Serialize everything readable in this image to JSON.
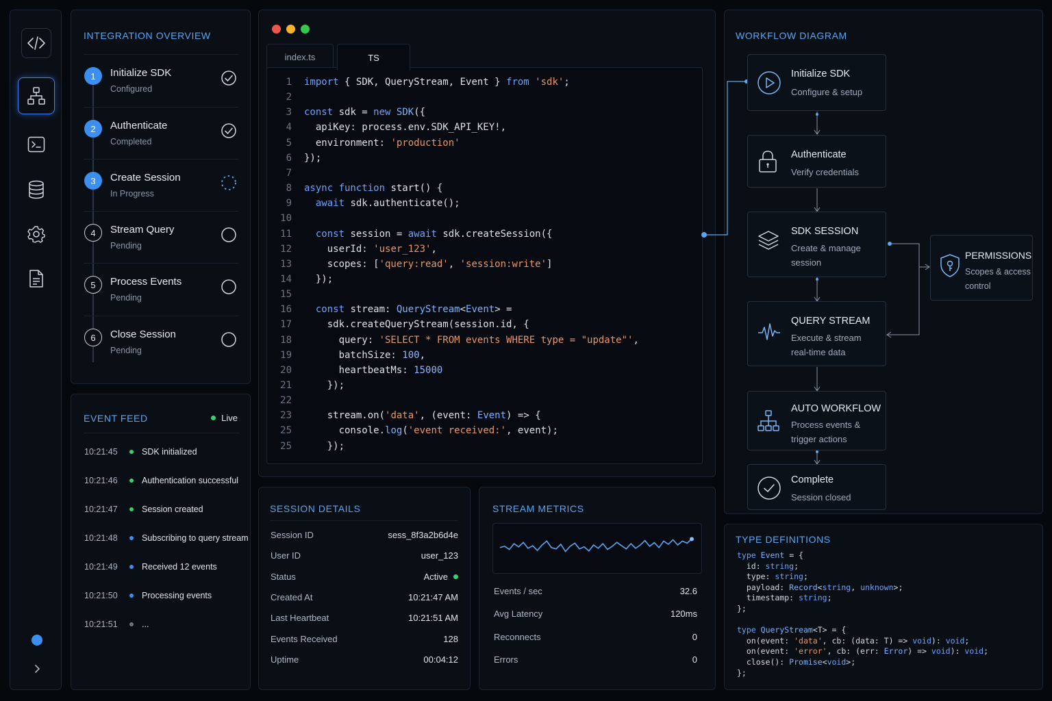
{
  "sidebar": {
    "icons": [
      "code-icon",
      "workflow-icon",
      "terminal-icon",
      "database-icon",
      "gear-icon",
      "document-icon"
    ],
    "active": "workflow-icon",
    "expand": "chevron-right-icon"
  },
  "overview": {
    "title": "INTEGRATION OVERVIEW",
    "steps": [
      {
        "num": "1",
        "title": "Initialize SDK",
        "status": "Configured",
        "state": "done"
      },
      {
        "num": "2",
        "title": "Authenticate",
        "status": "Completed",
        "state": "done"
      },
      {
        "num": "3",
        "title": "Create Session",
        "status": "In Progress",
        "state": "progress"
      },
      {
        "num": "4",
        "title": "Stream Query",
        "status": "Pending",
        "state": "pending"
      },
      {
        "num": "5",
        "title": "Process Events",
        "status": "Pending",
        "state": "pending"
      },
      {
        "num": "6",
        "title": "Close Session",
        "status": "Pending",
        "state": "pending"
      }
    ]
  },
  "feed": {
    "title": "EVENT FEED",
    "live": "Live",
    "rows": [
      {
        "time": "10:21:45",
        "msg": "SDK initialized",
        "color": "#3ccf6e"
      },
      {
        "time": "10:21:46",
        "msg": "Authentication successful",
        "color": "#3ccf6e"
      },
      {
        "time": "10:21:47",
        "msg": "Session created",
        "color": "#3ccf6e"
      },
      {
        "time": "10:21:48",
        "msg": "Subscribing to query stream",
        "color": "#3b8ff0"
      },
      {
        "time": "10:21:49",
        "msg": "Received 12 events",
        "color": "#3b8ff0"
      },
      {
        "time": "10:21:50",
        "msg": "Processing events",
        "color": "#3b8ff0"
      },
      {
        "time": "10:21:51",
        "msg": "...",
        "color": "#6b7686"
      }
    ]
  },
  "editor": {
    "tabs": [
      "index.ts",
      "TS"
    ],
    "active_tab": "TS",
    "lines": [
      {
        "n": "1",
        "src": "<span class='k'>import</span> { SDK, QueryStream, Event } <span class='k'>from</span> <span class='s'>'sdk'</span>;"
      },
      {
        "n": "2",
        "src": ""
      },
      {
        "n": "3",
        "src": "<span class='k'>const</span> sdk = <span class='k'>new</span> <span class='t'>SDK</span>({"
      },
      {
        "n": "4",
        "src": "  apiKey: process.env.SDK_API_KEY!,"
      },
      {
        "n": "5",
        "src": "  environment: <span class='s'>'production'</span>"
      },
      {
        "n": "6",
        "src": "});"
      },
      {
        "n": "7",
        "src": ""
      },
      {
        "n": "8",
        "src": "<span class='k'>async function</span> <span class='f'>start</span>() {"
      },
      {
        "n": "9",
        "src": "  <span class='k'>await</span> sdk.authenticate();"
      },
      {
        "n": "10",
        "src": ""
      },
      {
        "n": "11",
        "src": "  <span class='k'>const</span> session = <span class='k'>await</span> sdk.createSession({"
      },
      {
        "n": "12",
        "src": "    userId: <span class='s'>'user_123'</span>,"
      },
      {
        "n": "13",
        "src": "    scopes: [<span class='s'>'query:read'</span>, <span class='s'>'session:write'</span>]"
      },
      {
        "n": "14",
        "src": "  });"
      },
      {
        "n": "15",
        "src": ""
      },
      {
        "n": "16",
        "src": "  <span class='k'>const</span> stream: <span class='t'>QueryStream</span>&lt;<span class='t'>Event</span>&gt; ="
      },
      {
        "n": "17",
        "src": "    sdk.createQueryStream(session.id, {"
      },
      {
        "n": "18",
        "src": "      query: <span class='s'>'SELECT * FROM events WHERE type = \"update\"'</span>,"
      },
      {
        "n": "19",
        "src": "      batchSize: <span class='n'>100</span>,"
      },
      {
        "n": "20",
        "src": "      heartbeatMs: <span class='n'>15000</span>"
      },
      {
        "n": "21",
        "src": "    });"
      },
      {
        "n": "22",
        "src": ""
      },
      {
        "n": "23",
        "src": "    stream.on(<span class='s'>'data'</span>, (event: <span class='t'>Event</span>) =&gt; {"
      },
      {
        "n": "25",
        "src": "      console.<span class='t'>log</span>(<span class='s'>'event received:'</span>, event);"
      },
      {
        "n": "25",
        "src": "    });"
      }
    ]
  },
  "session": {
    "title": "SESSION DETAILS",
    "rows": [
      {
        "key": "Session ID",
        "val": "sess_8f3a2b6d4e"
      },
      {
        "key": "User ID",
        "val": "user_123"
      },
      {
        "key": "Status",
        "val": "Active"
      },
      {
        "key": "Created At",
        "val": "10:21:47 AM"
      },
      {
        "key": "Last Heartbeat",
        "val": "10:21:51 AM"
      },
      {
        "key": "Events Received",
        "val": "128"
      },
      {
        "key": "Uptime",
        "val": "00:04:12"
      }
    ],
    "status_color": "#3ccf6e"
  },
  "metrics": {
    "title": "STREAM METRICS",
    "rows": [
      {
        "key": "Events / sec",
        "val": "32.6"
      },
      {
        "key": "Avg Latency",
        "val": "120ms"
      },
      {
        "key": "Reconnects",
        "val": "0"
      },
      {
        "key": "Errors",
        "val": "0"
      }
    ],
    "sparkline": [
      0.55,
      0.5,
      0.62,
      0.4,
      0.52,
      0.35,
      0.58,
      0.48,
      0.66,
      0.45,
      0.3,
      0.55,
      0.6,
      0.42,
      0.7,
      0.5,
      0.38,
      0.6,
      0.52,
      0.68,
      0.45,
      0.58,
      0.4,
      0.62,
      0.5,
      0.35,
      0.48,
      0.6,
      0.4,
      0.58,
      0.45,
      0.28,
      0.5,
      0.36,
      0.55,
      0.3,
      0.42,
      0.25,
      0.45,
      0.3,
      0.38,
      0.22
    ]
  },
  "workflow": {
    "title": "WORKFLOW DIAGRAM",
    "nodes": [
      {
        "title": "Initialize SDK",
        "sub": "Configure & setup",
        "icon": "play-icon"
      },
      {
        "title": "Authenticate",
        "sub": "Verify credentials",
        "icon": "lock-icon"
      },
      {
        "title": "SDK SESSION",
        "sub": "Create & manage session",
        "icon": "layers-icon"
      },
      {
        "title": "QUERY STREAM",
        "sub": "Execute & stream real-time data",
        "icon": "pulse-icon"
      },
      {
        "title": "AUTO WORKFLOW",
        "sub": "Process events & trigger actions",
        "icon": "workflow-icon"
      },
      {
        "title": "Complete",
        "sub": "Session closed",
        "icon": "check-circle-icon"
      }
    ],
    "side": {
      "title": "PERMISSIONS",
      "sub": "Scopes & access control",
      "icon": "shield-key-icon"
    }
  },
  "types": {
    "title": "TYPE DEFINITIONS",
    "lines": [
      "<span class='k'>type</span> <span class='t'>Event</span> = {",
      "  id: <span class='k'>string</span>;",
      "  type: <span class='k'>string</span>;",
      "  payload: <span class='t'>Record</span>&lt;<span class='k'>string</span>, <span class='k'>unknown</span>&gt;;",
      "  timestamp: <span class='k'>string</span>;",
      "};",
      "",
      "<span class='k'>type</span> <span class='t'>QueryStream</span>&lt;T&gt; = {",
      "  on(event: <span class='s'>'data'</span>, cb: (data: T) =&gt; <span class='k'>void</span>): <span class='k'>void</span>;",
      "  on(event: <span class='s'>'error'</span>, cb: (err: <span class='t'>Error</span>) =&gt; <span class='k'>void</span>): <span class='k'>void</span>;",
      "  close(): <span class='t'>Promise</span>&lt;<span class='k'>void</span>&gt;;",
      "};"
    ]
  },
  "colors": {
    "accent": "#3b8ff0",
    "success": "#3ccf6e",
    "window_red": "#f0554a",
    "window_yellow": "#f5b52d",
    "window_green": "#35c84a"
  }
}
